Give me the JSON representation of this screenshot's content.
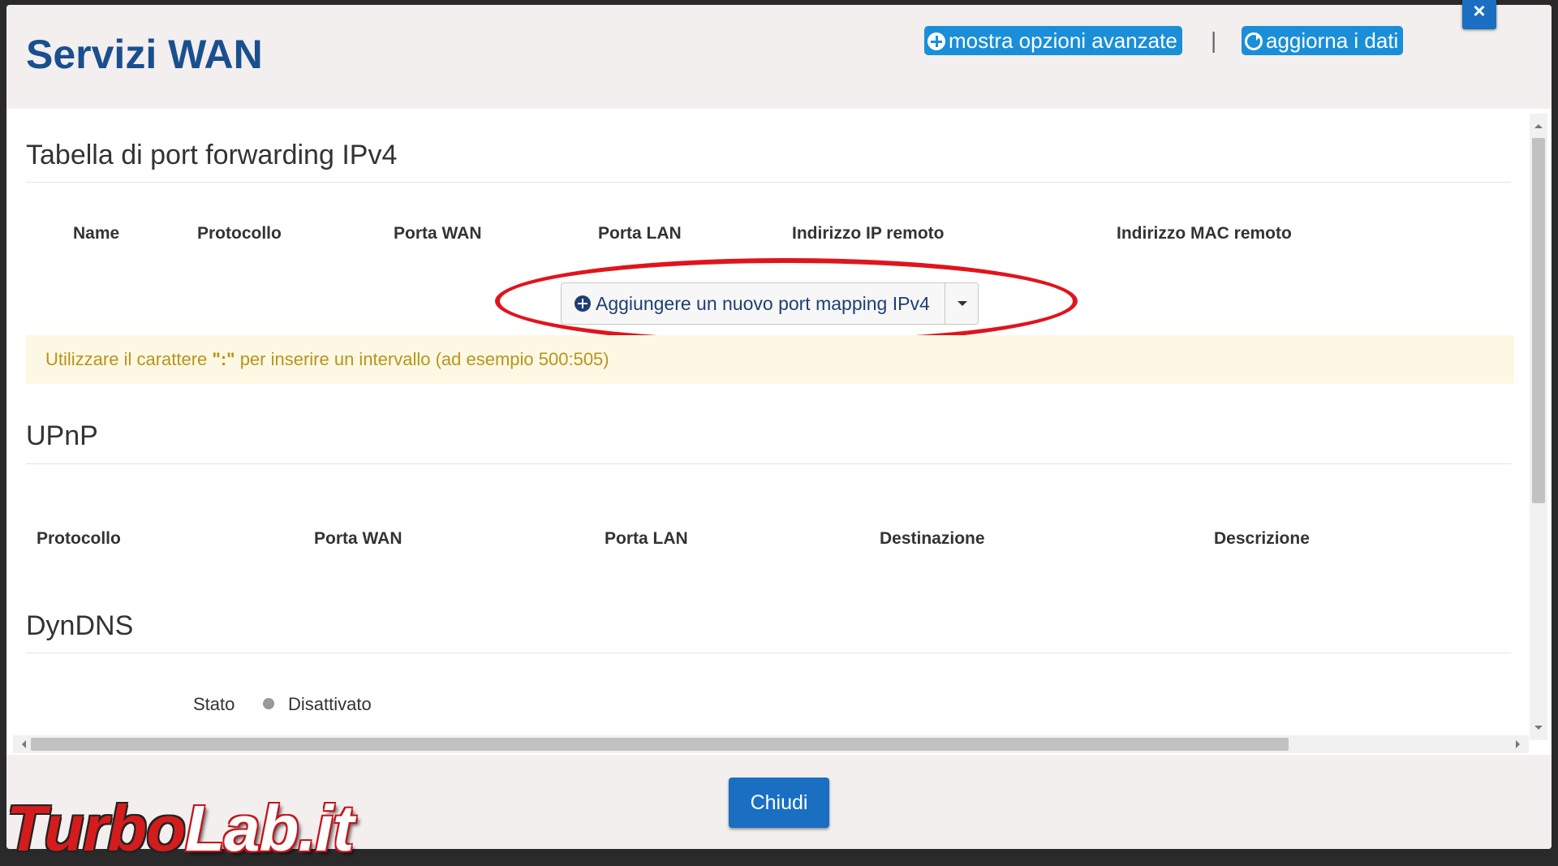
{
  "modal": {
    "title": "Servizi WAN",
    "show_advanced_label": "mostra opzioni avanzate",
    "separator": "|",
    "refresh_label": "aggiorna i dati",
    "close_icon": "×"
  },
  "port_forwarding": {
    "title": "Tabella di port forwarding IPv4",
    "columns": [
      "Name",
      "Protocollo",
      "Porta WAN",
      "Porta LAN",
      "Indirizzo IP remoto",
      "Indirizzo MAC remoto"
    ],
    "add_button_label": "Aggiungere un nuovo port mapping IPv4",
    "hint_prefix": "Utilizzare il carattere ",
    "hint_char": "\":\"",
    "hint_suffix": " per inserire un intervallo (ad esempio 500:505)"
  },
  "upnp": {
    "title": "UPnP",
    "columns": [
      "Protocollo",
      "Porta WAN",
      "Porta LAN",
      "Destinazione",
      "Descrizione"
    ]
  },
  "dyndns": {
    "title": "DynDNS",
    "status_label": "Stato",
    "status_value": "Disattivato",
    "status_color": "#999999"
  },
  "footer": {
    "close_label": "Chiudi"
  },
  "watermark": {
    "part1": "Turbo",
    "part2": "Lab.it"
  },
  "colors": {
    "title": "#1a4f8f",
    "button_blue": "#1a8fd8",
    "primary": "#1a6fc2",
    "highlight_ellipse": "#e0141c",
    "alert_bg": "#fcf8e3",
    "alert_text": "#b8941c"
  }
}
